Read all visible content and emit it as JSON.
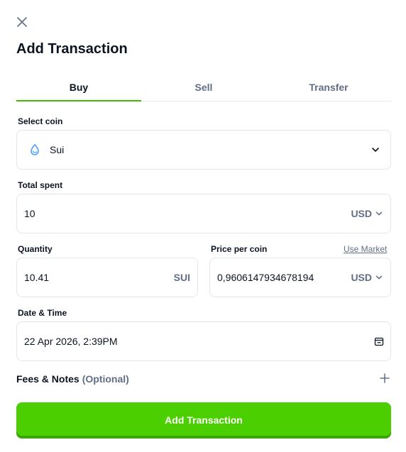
{
  "dialog": {
    "title": "Add Transaction"
  },
  "icons": {
    "close": "close-icon",
    "coin": "sui-drop-icon",
    "dropdown": "chevron-down-icon",
    "calendar": "calendar-icon",
    "expand": "plus-icon"
  },
  "colors": {
    "accent": "#4ccf00",
    "tab_underline": "#3dbd00",
    "muted_text": "#616e85",
    "text": "#0d1421",
    "sui_blue": "#4da2ff"
  },
  "tabs": [
    {
      "label": "Buy",
      "active": true
    },
    {
      "label": "Sell",
      "active": false
    },
    {
      "label": "Transfer",
      "active": false
    }
  ],
  "form": {
    "coin": {
      "label": "Select coin",
      "value": "Sui"
    },
    "total_spent": {
      "label": "Total spent",
      "value": "10",
      "currency": "USD"
    },
    "quantity": {
      "label": "Quantity",
      "value": "10.41",
      "unit": "SUI"
    },
    "price_per_coin": {
      "label": "Price per coin",
      "link": "Use Market",
      "value": "0,9606147934678194",
      "currency": "USD"
    },
    "date_time": {
      "label": "Date & Time",
      "value": "22 Apr 2026, 2:39PM"
    },
    "fees_notes": {
      "label": "Fees & Notes",
      "optional": "(Optional)"
    }
  },
  "submit": {
    "label": "Add Transaction"
  }
}
